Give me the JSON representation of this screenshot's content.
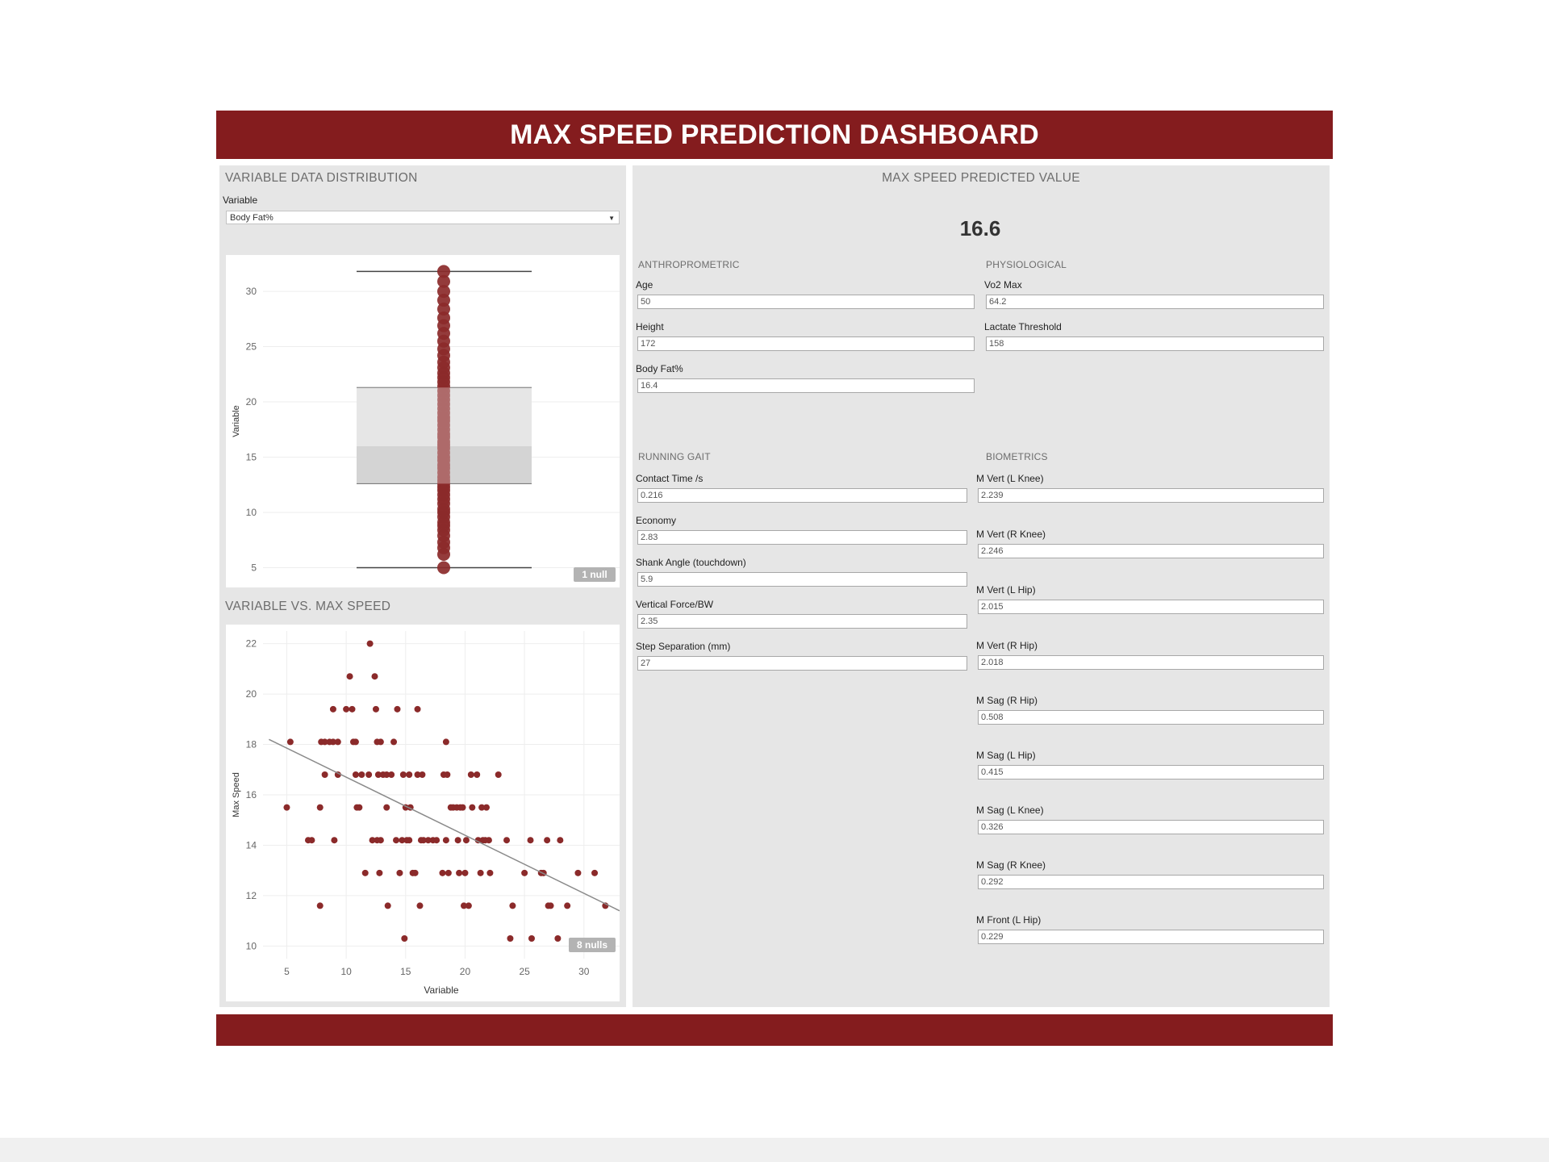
{
  "header": {
    "title": "MAX SPEED PREDICTION DASHBOARD"
  },
  "left": {
    "distribution_title": "VARIABLE DATA DISTRIBUTION",
    "variable_label": "Variable",
    "variable_selected": "Body Fat%",
    "box_null_badge": "1 null",
    "scatter_title": "VARIABLE VS. MAX SPEED",
    "scatter_null_badge": "8 nulls"
  },
  "right": {
    "title": "MAX SPEED PREDICTED VALUE",
    "predicted_value": "16.6",
    "groups": {
      "anthropometric": "ANTHROPROMETRIC",
      "physiological": "PHYSIOLOGICAL",
      "running_gait": "RUNNING GAIT",
      "biometrics": "BIOMETRICS"
    },
    "fields": {
      "age": {
        "label": "Age",
        "value": "50"
      },
      "height": {
        "label": "Height",
        "value": "172"
      },
      "body_fat": {
        "label": "Body Fat%",
        "value": "16.4"
      },
      "vo2": {
        "label": "Vo2 Max",
        "value": "64.2"
      },
      "lactate": {
        "label": "Lactate Threshold",
        "value": "158"
      },
      "contact_time": {
        "label": "Contact Time /s",
        "value": "0.216"
      },
      "economy": {
        "label": "Economy",
        "value": "2.83"
      },
      "shank_angle": {
        "label": "Shank Angle (touchdown)",
        "value": "5.9"
      },
      "vertical_force": {
        "label": "Vertical Force/BW",
        "value": "2.35"
      },
      "step_sep": {
        "label": "Step Separation (mm)",
        "value": "27"
      },
      "mvert_lknee": {
        "label": "M Vert (L Knee)",
        "value": "2.239"
      },
      "mvert_rknee": {
        "label": "M Vert (R Knee)",
        "value": "2.246"
      },
      "mvert_lhip": {
        "label": "M Vert (L Hip)",
        "value": "2.015"
      },
      "mvert_rhip": {
        "label": "M Vert (R Hip)",
        "value": "2.018"
      },
      "msag_rhip": {
        "label": "M Sag (R Hip)",
        "value": "0.508"
      },
      "msag_lhip": {
        "label": "M Sag (L Hip)",
        "value": "0.415"
      },
      "msag_lknee": {
        "label": "M Sag (L Knee)",
        "value": "0.326"
      },
      "msag_rknee": {
        "label": "M Sag (R Knee)",
        "value": "0.292"
      },
      "mfront_lhip": {
        "label": "M Front (L Hip)",
        "value": "0.229"
      }
    }
  },
  "colors": {
    "brand": "#841c1e",
    "mark": "#8b2a2a",
    "panel": "#e6e6e6"
  },
  "chart_data": [
    {
      "type": "boxplot",
      "ylabel": "Variable",
      "ylim": [
        3.5,
        33
      ],
      "yticks": [
        5,
        10,
        15,
        20,
        25,
        30
      ],
      "box": {
        "whisker_low": 5.0,
        "q1": 12.6,
        "median": 16.0,
        "q3": 21.3,
        "whisker_high": 31.8
      },
      "points": [
        5.0,
        6.2,
        6.8,
        7.3,
        7.9,
        8.4,
        8.8,
        9.1,
        9.6,
        10.0,
        10.3,
        10.8,
        11.2,
        11.6,
        12.0,
        12.3,
        12.6,
        12.9,
        13.2,
        13.6,
        14.0,
        14.3,
        14.7,
        15.0,
        15.4,
        15.8,
        16.1,
        16.4,
        16.8,
        17.1,
        17.5,
        17.9,
        18.3,
        18.6,
        19.0,
        19.4,
        19.8,
        20.2,
        20.6,
        21.0,
        21.4,
        21.8,
        22.2,
        22.6,
        23.1,
        23.6,
        24.2,
        24.8,
        25.5,
        26.2,
        26.9,
        27.6,
        28.4,
        29.2,
        30.0,
        30.9,
        31.8
      ],
      "nulls": 1
    },
    {
      "type": "scatter",
      "xlabel": "Variable",
      "ylabel": "Max Speed",
      "xlim": [
        3,
        33
      ],
      "ylim": [
        9.5,
        22.5
      ],
      "xticks": [
        5,
        10,
        15,
        20,
        25,
        30
      ],
      "yticks": [
        10,
        12,
        14,
        16,
        18,
        20,
        22
      ],
      "trendline": {
        "x1": 3.5,
        "y1": 18.2,
        "x2": 33,
        "y2": 11.4
      },
      "points": [
        [
          5.0,
          15.5
        ],
        [
          5.3,
          18.1
        ],
        [
          6.8,
          14.2
        ],
        [
          7.1,
          14.2
        ],
        [
          7.8,
          11.6
        ],
        [
          7.8,
          15.5
        ],
        [
          7.9,
          18.1
        ],
        [
          8.2,
          16.8
        ],
        [
          8.2,
          18.1
        ],
        [
          8.6,
          18.1
        ],
        [
          8.9,
          19.4
        ],
        [
          8.9,
          18.1
        ],
        [
          9.0,
          14.2
        ],
        [
          9.3,
          16.8
        ],
        [
          9.3,
          18.1
        ],
        [
          10.0,
          19.4
        ],
        [
          10.3,
          20.7
        ],
        [
          10.5,
          19.4
        ],
        [
          10.6,
          18.1
        ],
        [
          10.8,
          18.1
        ],
        [
          10.8,
          16.8
        ],
        [
          10.9,
          15.5
        ],
        [
          11.1,
          15.5
        ],
        [
          11.3,
          16.8
        ],
        [
          11.6,
          12.9
        ],
        [
          11.9,
          16.8
        ],
        [
          12.0,
          22.0
        ],
        [
          12.2,
          14.2
        ],
        [
          12.4,
          20.7
        ],
        [
          12.5,
          19.4
        ],
        [
          12.6,
          18.1
        ],
        [
          12.6,
          14.2
        ],
        [
          12.7,
          16.8
        ],
        [
          12.8,
          12.9
        ],
        [
          12.9,
          18.1
        ],
        [
          12.9,
          14.2
        ],
        [
          13.1,
          16.8
        ],
        [
          13.4,
          16.8
        ],
        [
          13.4,
          15.5
        ],
        [
          13.5,
          11.6
        ],
        [
          13.8,
          16.8
        ],
        [
          14.0,
          18.1
        ],
        [
          14.2,
          14.2
        ],
        [
          14.3,
          19.4
        ],
        [
          14.5,
          12.9
        ],
        [
          14.7,
          14.2
        ],
        [
          14.8,
          16.8
        ],
        [
          14.9,
          10.3
        ],
        [
          15.0,
          15.5
        ],
        [
          15.1,
          14.2
        ],
        [
          15.3,
          16.8
        ],
        [
          15.3,
          14.2
        ],
        [
          15.4,
          15.5
        ],
        [
          15.6,
          12.9
        ],
        [
          15.8,
          12.9
        ],
        [
          16.0,
          19.4
        ],
        [
          16.0,
          16.8
        ],
        [
          16.2,
          11.6
        ],
        [
          16.3,
          14.2
        ],
        [
          16.4,
          16.8
        ],
        [
          16.5,
          14.2
        ],
        [
          16.9,
          14.2
        ],
        [
          17.3,
          14.2
        ],
        [
          17.6,
          14.2
        ],
        [
          18.1,
          12.9
        ],
        [
          18.2,
          16.8
        ],
        [
          18.4,
          18.1
        ],
        [
          18.4,
          14.2
        ],
        [
          18.5,
          16.8
        ],
        [
          18.6,
          12.9
        ],
        [
          18.8,
          15.5
        ],
        [
          19.0,
          15.5
        ],
        [
          19.3,
          15.5
        ],
        [
          19.4,
          14.2
        ],
        [
          19.5,
          12.9
        ],
        [
          19.6,
          15.5
        ],
        [
          19.8,
          15.5
        ],
        [
          19.9,
          11.6
        ],
        [
          20.0,
          12.9
        ],
        [
          20.1,
          14.2
        ],
        [
          20.3,
          11.6
        ],
        [
          20.5,
          16.8
        ],
        [
          20.6,
          15.5
        ],
        [
          21.0,
          16.8
        ],
        [
          21.1,
          14.2
        ],
        [
          21.3,
          12.9
        ],
        [
          21.4,
          15.5
        ],
        [
          21.5,
          14.2
        ],
        [
          21.7,
          14.2
        ],
        [
          21.8,
          15.5
        ],
        [
          22.0,
          14.2
        ],
        [
          22.1,
          12.9
        ],
        [
          22.8,
          16.8
        ],
        [
          23.5,
          14.2
        ],
        [
          23.8,
          10.3
        ],
        [
          24.0,
          11.6
        ],
        [
          25.0,
          12.9
        ],
        [
          25.5,
          14.2
        ],
        [
          25.6,
          10.3
        ],
        [
          26.4,
          12.9
        ],
        [
          26.6,
          12.9
        ],
        [
          26.9,
          14.2
        ],
        [
          27.0,
          11.6
        ],
        [
          27.2,
          11.6
        ],
        [
          27.8,
          10.3
        ],
        [
          28.0,
          14.2
        ],
        [
          28.6,
          11.6
        ],
        [
          29.5,
          12.9
        ],
        [
          30.9,
          12.9
        ],
        [
          31.8,
          11.6
        ]
      ],
      "nulls": 8
    }
  ]
}
